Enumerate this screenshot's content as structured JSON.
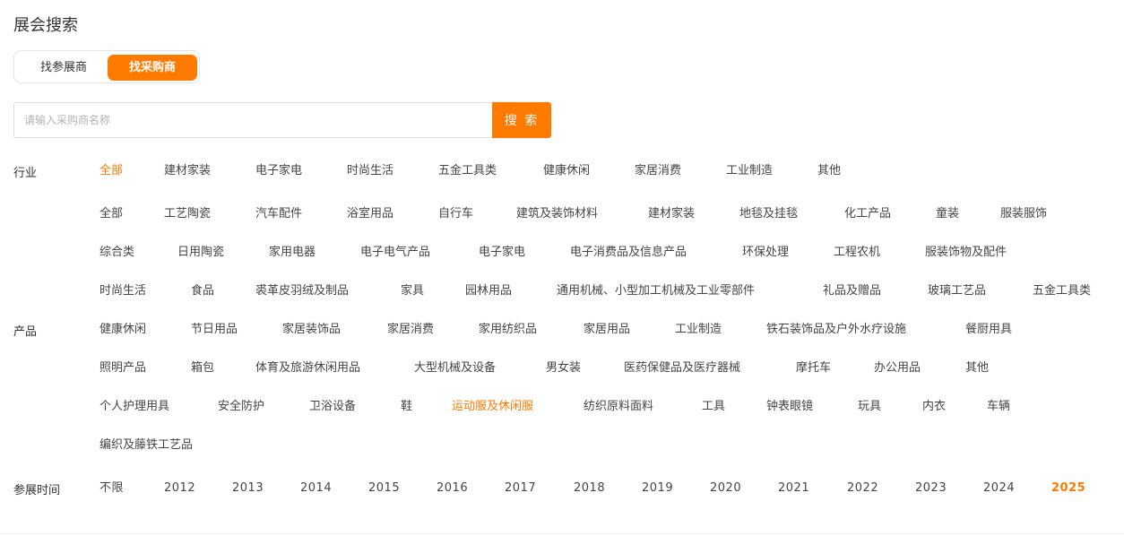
{
  "page": {
    "title": "展会搜索"
  },
  "tabs": [
    {
      "label": "找参展商",
      "active": false
    },
    {
      "label": "找采购商",
      "active": true
    }
  ],
  "search": {
    "placeholder": "请输入采购商名称",
    "value": "",
    "button_label": "搜 索"
  },
  "filters": {
    "industry": {
      "label": "行业",
      "options": [
        "全部",
        "建材家装",
        "电子家电",
        "时尚生活",
        "五金工具类",
        "健康休闲",
        "家居消费",
        "工业制造",
        "其他"
      ],
      "selected": "全部"
    },
    "product": {
      "label": "产品",
      "options": [
        "全部",
        "工艺陶瓷",
        "汽车配件",
        "浴室用品",
        "自行车",
        "建筑及装饰材料",
        "建材家装",
        "地毯及挂毯",
        "化工产品",
        "童装",
        "服装服饰",
        "综合类",
        "日用陶瓷",
        "家用电器",
        "电子电气产品",
        "电子家电",
        "电子消费品及信息产品",
        "环保处理",
        "工程农机",
        "服装饰物及配件",
        "时尚生活",
        "食品",
        "裘革皮羽绒及制品",
        "家具",
        "园林用品",
        "通用机械、小型加工机械及工业零部件",
        "礼品及赠品",
        "玻璃工艺品",
        "五金工具类",
        "健康休闲",
        "节日用品",
        "家居装饰品",
        "家居消费",
        "家用纺织品",
        "家居用品",
        "工业制造",
        "铁石装饰品及户外水疗设施",
        "餐厨用具",
        "照明产品",
        "箱包",
        "体育及旅游休闲用品",
        "大型机械及设备",
        "男女装",
        "医药保健品及医疗器械",
        "摩托车",
        "办公用品",
        "其他",
        "个人护理用具",
        "安全防护",
        "卫浴设备",
        "鞋",
        "运动服及休闲服",
        "纺织原料面料",
        "工具",
        "钟表眼镜",
        "玩具",
        "内衣",
        "车辆",
        "编织及藤铁工艺品"
      ],
      "selected": "运动服及休闲服"
    },
    "year": {
      "label": "参展时间",
      "options": [
        "不限",
        "2012",
        "2013",
        "2014",
        "2015",
        "2016",
        "2017",
        "2018",
        "2019",
        "2020",
        "2021",
        "2022",
        "2023",
        "2024",
        "2025"
      ],
      "selected": "2025"
    }
  },
  "colors": {
    "accent": "#ff7a00",
    "text": "#333333",
    "border": "#dcdcdc"
  }
}
